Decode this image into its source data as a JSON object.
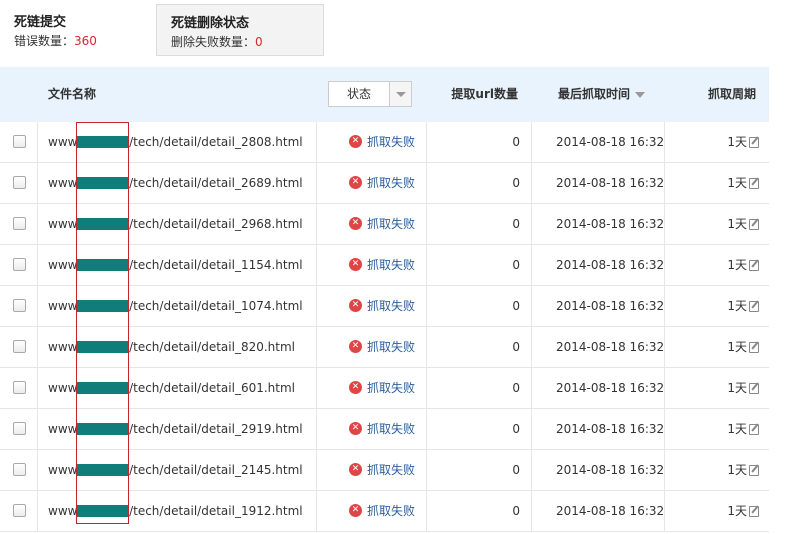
{
  "tabs": [
    {
      "title": "死链提交",
      "sub_label": "错误数量：",
      "count": "360"
    },
    {
      "title": "死链删除状态",
      "sub_label": "删除失败数量：",
      "count": "0"
    }
  ],
  "table": {
    "headers": {
      "name": "文件名称",
      "status": "状态",
      "count": "提取url数量",
      "time": "最后抓取时间",
      "cycle": "抓取周期"
    },
    "rows": [
      {
        "prefix": "www",
        "suffix": "com/tech/detail/detail_2808.html",
        "status": "抓取失败",
        "count": "0",
        "time": "2014-08-18 16:32",
        "cycle": "1天"
      },
      {
        "prefix": "www",
        "suffix": "com/tech/detail/detail_2689.html",
        "status": "抓取失败",
        "count": "0",
        "time": "2014-08-18 16:32",
        "cycle": "1天"
      },
      {
        "prefix": "www",
        "suffix": "com/tech/detail/detail_2968.html",
        "status": "抓取失败",
        "count": "0",
        "time": "2014-08-18 16:32",
        "cycle": "1天"
      },
      {
        "prefix": "www",
        "suffix": "com/tech/detail/detail_1154.html",
        "status": "抓取失败",
        "count": "0",
        "time": "2014-08-18 16:32",
        "cycle": "1天"
      },
      {
        "prefix": "www",
        "suffix": "com/tech/detail/detail_1074.html",
        "status": "抓取失败",
        "count": "0",
        "time": "2014-08-18 16:32",
        "cycle": "1天"
      },
      {
        "prefix": "www",
        "suffix": "com/tech/detail/detail_820.html",
        "status": "抓取失败",
        "count": "0",
        "time": "2014-08-18 16:32",
        "cycle": "1天"
      },
      {
        "prefix": "www",
        "suffix": "com/tech/detail/detail_601.html",
        "status": "抓取失败",
        "count": "0",
        "time": "2014-08-18 16:32",
        "cycle": "1天"
      },
      {
        "prefix": "www",
        "suffix": "com/tech/detail/detail_2919.html",
        "status": "抓取失败",
        "count": "0",
        "time": "2014-08-18 16:32",
        "cycle": "1天"
      },
      {
        "prefix": "www",
        "suffix": "com/tech/detail/detail_2145.html",
        "status": "抓取失败",
        "count": "0",
        "time": "2014-08-18 16:32",
        "cycle": "1天"
      },
      {
        "prefix": "www",
        "suffix": "com/tech/detail/detail_1912.html",
        "status": "抓取失败",
        "count": "0",
        "time": "2014-08-18 16:32",
        "cycle": "1天"
      }
    ]
  },
  "icons": {
    "status": "error-circle-icon",
    "cycle": "edit-icon",
    "sort": "sort-down-icon",
    "dropdown": "chevron-down-icon"
  },
  "colors": {
    "accent_count": "#d42a2a",
    "header_bg": "#e8f3fd",
    "redaction": "#117d7a",
    "highlight_border": "#c0272d",
    "status_text": "#2c5f9e"
  }
}
